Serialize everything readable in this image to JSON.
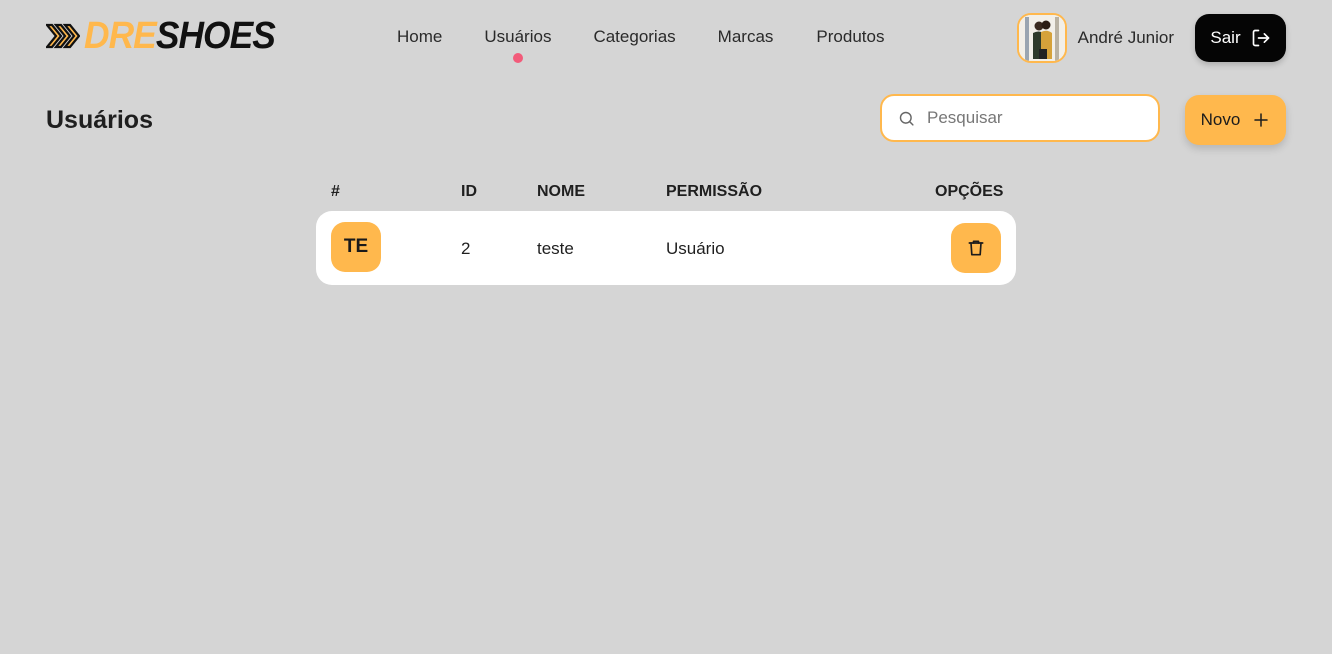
{
  "brand": {
    "accent_text": "DRE",
    "main_text": "SHOES",
    "accent_color": "#ffb84d"
  },
  "nav": {
    "items": [
      {
        "label": "Home",
        "active": false
      },
      {
        "label": "Usuários",
        "active": true
      },
      {
        "label": "Categorias",
        "active": false
      },
      {
        "label": "Marcas",
        "active": false
      },
      {
        "label": "Produtos",
        "active": false
      }
    ],
    "active_indicator_color": "#f25b7a"
  },
  "user": {
    "name": "André Junior",
    "avatar_icon": "user-photo",
    "logout_label": "Sair",
    "logout_icon": "logout-icon"
  },
  "page": {
    "title": "Usuários"
  },
  "search": {
    "placeholder": "Pesquisar",
    "value": "",
    "icon": "search-icon"
  },
  "toolbar": {
    "new_label": "Novo",
    "new_icon": "plus-icon"
  },
  "table": {
    "headers": {
      "hash": "#",
      "id": "ID",
      "name": "NOME",
      "permission": "PERMISSÃO",
      "options": "OPÇÕES"
    },
    "rows": [
      {
        "initials": "TE",
        "id": "2",
        "name": "teste",
        "permission": "Usuário",
        "action_icon": "trash-icon"
      }
    ]
  },
  "colors": {
    "background": "#d5d5d5",
    "accent": "#ffb84d",
    "dark_button": "#050505"
  }
}
